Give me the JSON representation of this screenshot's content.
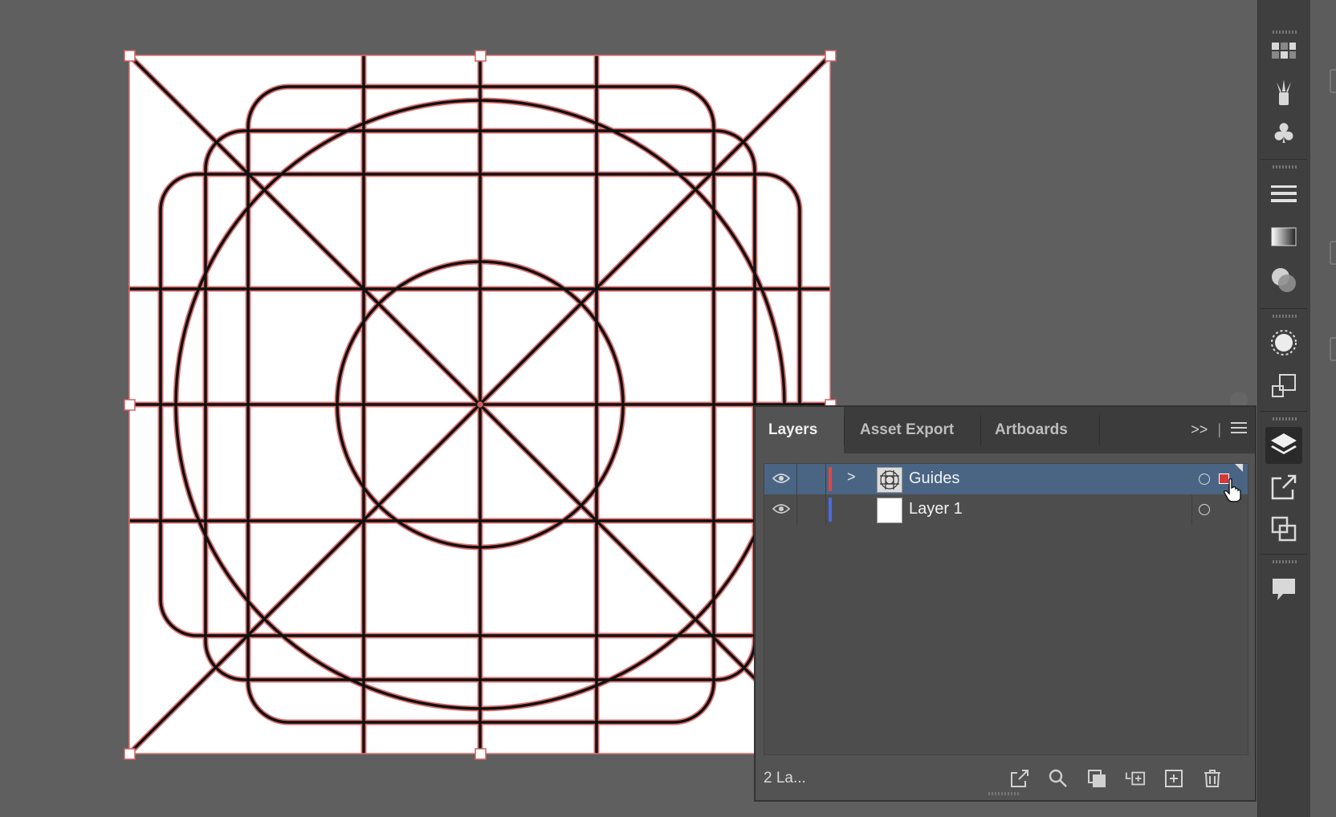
{
  "layers_panel": {
    "tabs": [
      "Layers",
      "Asset Export",
      "Artboards"
    ],
    "overflow_label": ">>",
    "layers": [
      {
        "name": "Guides",
        "color": "#d94a4a",
        "selected": true,
        "expandable": true
      },
      {
        "name": "Layer 1",
        "color": "#4a6cd9",
        "selected": false,
        "expandable": false
      }
    ],
    "count_label": "2 La..."
  },
  "colors": {
    "canvas_bg": "#5f5f5f",
    "selection": "#e07070",
    "layer_selected": "#4a6584"
  },
  "toolbar_icons": [
    "swatches-icon",
    "brushes-icon",
    "symbols-icon",
    "stroke-icon",
    "gradient-icon",
    "transparency-icon",
    "appearance-icon",
    "transform-icon",
    "layers-icon",
    "export-icon",
    "artboards-icon",
    "comments-icon"
  ]
}
